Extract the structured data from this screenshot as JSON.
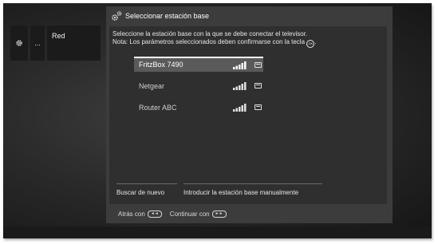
{
  "side": {
    "gear_icon": "gear-icon",
    "dots_label": "...",
    "red_label": "Red"
  },
  "dialog": {
    "title": "Seleccionar estación base",
    "description_line1": "Seleccione la estación base con la que se debe conectar el televisor.",
    "description_line2": "Nota: Los parámetros seleccionados deben confirmarse con la tecla",
    "ok_key_label": "OK"
  },
  "networks": [
    {
      "name": "FritzBox 7490",
      "selected": true,
      "signal_bars": 5,
      "secured": true
    },
    {
      "name": "Netgear",
      "selected": false,
      "signal_bars": 5,
      "secured": true
    },
    {
      "name": "Router ABC",
      "selected": false,
      "signal_bars": 5,
      "secured": true
    }
  ],
  "buttons": {
    "rescan": "Buscar de nuevo",
    "manual": "Introducir la estación base manualmente"
  },
  "footer": {
    "back_label": "Atrás con",
    "back_key": "◄◄",
    "continue_label": "Continuar con",
    "continue_key": "►►"
  },
  "colors": {
    "dialog_bg": "#3c3c3c",
    "selected_bg": "#5a5a5a",
    "text": "#e6e6e6"
  }
}
